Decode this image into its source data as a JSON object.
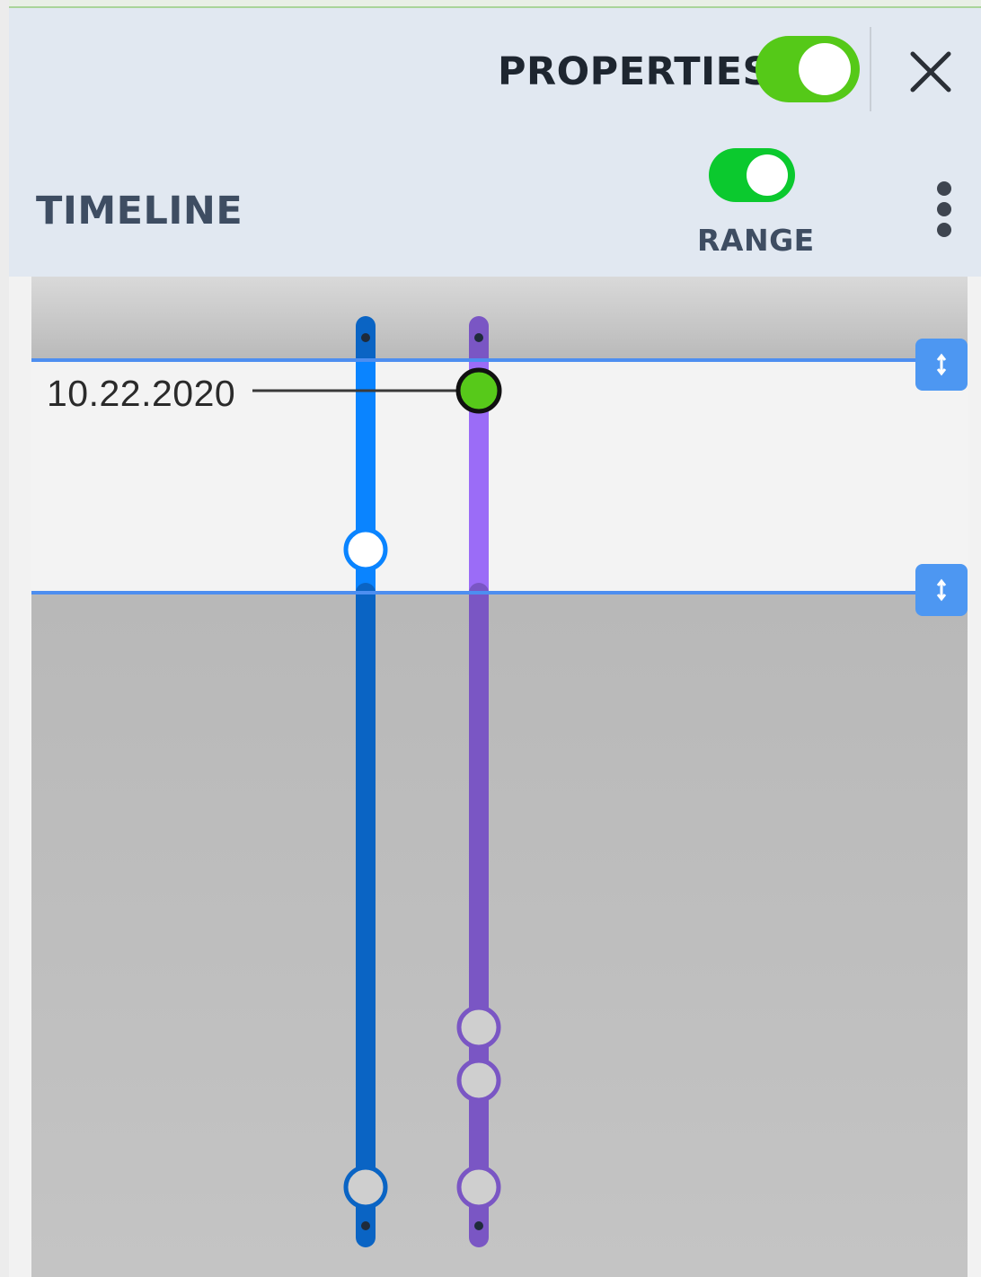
{
  "header": {
    "properties_label": "PROPERTIES",
    "properties_toggle_on": true,
    "close_icon": "close-icon"
  },
  "toolbar": {
    "title": "TIMELINE",
    "range_label": "RANGE",
    "range_toggle_on": true,
    "more_icon": "more-vertical-icon"
  },
  "timeline": {
    "selected_date_label": "10.22.2020"
  },
  "colors": {
    "toggle_on": "#55c918",
    "range_toggle_on": "#0bc92e",
    "range_line": "#4d8ef0",
    "blue_track": "#0a84ff",
    "blue_track_dim": "#0a64c4",
    "purple_track": "#9b6cf7",
    "purple_track_dim": "#7a56c4",
    "selected_event": "#57c91a"
  }
}
